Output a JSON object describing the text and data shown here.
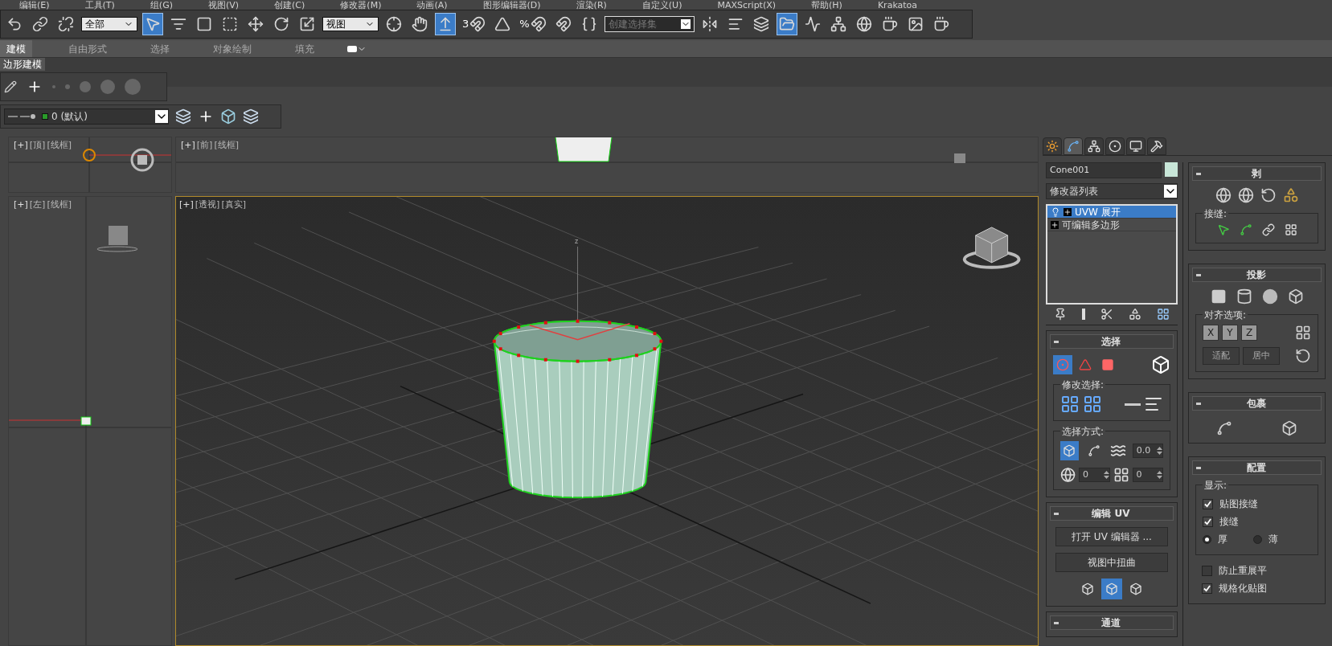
{
  "menu": [
    "编辑(E)",
    "工具(T)",
    "组(G)",
    "视图(V)",
    "创建(C)",
    "修改器(M)",
    "动画(A)",
    "图形编辑器(D)",
    "渲染(R)",
    "自定义(U)",
    "MAXScript(X)",
    "帮助(H)",
    "Krakatoa"
  ],
  "toolbar": [
    {
      "kind": "button",
      "selected": false
    },
    {
      "kind": "button",
      "selected": false
    },
    {
      "kind": "button",
      "selected": false
    },
    {
      "kind": "dropdown",
      "value": "全部"
    },
    {
      "kind": "button",
      "selected": true
    },
    {
      "kind": "button",
      "selected": false
    },
    {
      "kind": "button",
      "selected": false
    },
    {
      "kind": "button",
      "selected": false
    },
    {
      "kind": "button",
      "selected": false
    },
    {
      "kind": "button",
      "selected": false
    },
    {
      "kind": "button",
      "selected": false
    },
    {
      "kind": "dropdown",
      "value": "视图"
    },
    {
      "kind": "button",
      "selected": false
    },
    {
      "kind": "button",
      "selected": false
    },
    {
      "kind": "button",
      "selected": true
    },
    {
      "kind": "button",
      "selected": false,
      "label": "3"
    },
    {
      "kind": "button",
      "selected": false
    },
    {
      "kind": "button",
      "selected": false,
      "label": "%"
    },
    {
      "kind": "button",
      "selected": false
    },
    {
      "kind": "button",
      "selected": false
    },
    {
      "kind": "set_field",
      "placeholder": "创建选择集"
    },
    {
      "kind": "button",
      "selected": false
    },
    {
      "kind": "button",
      "selected": false
    },
    {
      "kind": "button",
      "selected": false
    },
    {
      "kind": "button",
      "selected": true
    },
    {
      "kind": "button",
      "selected": false
    },
    {
      "kind": "button",
      "selected": false
    },
    {
      "kind": "button",
      "selected": false
    },
    {
      "kind": "button",
      "selected": false
    },
    {
      "kind": "button",
      "selected": false
    },
    {
      "kind": "button",
      "selected": false
    }
  ],
  "ribbon": {
    "tabs": [
      {
        "label": "建模",
        "selected": true
      },
      {
        "label": "自由形式",
        "selected": false
      },
      {
        "label": "选择",
        "selected": false
      },
      {
        "label": "对象绘制",
        "selected": false
      },
      {
        "label": "填充",
        "selected": false
      }
    ],
    "panel_tab": "边形建模"
  },
  "layer": {
    "value": "0 (默认)"
  },
  "viewports": {
    "top": [
      "[+]",
      "[顶]",
      "[线框]"
    ],
    "front": [
      "[+]",
      "[前]",
      "[线框]"
    ],
    "left": [
      "[+]",
      "[左]",
      "[线框]"
    ],
    "perspective": [
      "[+]",
      "[透视]",
      "[真实]"
    ],
    "axis_label": "z"
  },
  "command_tabs": [
    {
      "selected": false
    },
    {
      "selected": true
    },
    {
      "selected": false
    },
    {
      "selected": false
    },
    {
      "selected": false
    },
    {
      "selected": false
    }
  ],
  "object_name": "Cone001",
  "modifier_list": "修改器列表",
  "stack": [
    {
      "label": "UVW 展开",
      "selected": true,
      "kind": "modifier"
    },
    {
      "label": "可编辑多边形",
      "selected": false,
      "kind": "base"
    }
  ],
  "selection": {
    "title": "选择",
    "subobject": [
      {
        "selected": true
      },
      {
        "selected": false
      },
      {
        "selected": false
      }
    ],
    "modify_label": "修改选择:",
    "method_label": "选择方式:",
    "method_buttons": [
      {
        "selected": true
      },
      {
        "selected": false
      }
    ],
    "angle": "0.0",
    "spin_a": "0",
    "spin_b": "0"
  },
  "edit_uv": {
    "title": "编辑 UV",
    "buttons": [
      "打开 UV 编辑器 ...",
      "视图中扭曲"
    ],
    "tools": [
      {
        "selected": false
      },
      {
        "selected": true
      },
      {
        "selected": false
      }
    ]
  },
  "channel": {
    "title": "通道"
  },
  "peel": {
    "title": "剥",
    "seams_label": "接缝:"
  },
  "projection": {
    "title": "投影",
    "align_label": "对齐选项:",
    "axes": [
      "X",
      "Y",
      "Z"
    ],
    "buttons": [
      "适配",
      "居中"
    ]
  },
  "wrap": {
    "title": "包裹"
  },
  "config": {
    "title": "配置",
    "display_label": "显示:",
    "checks": [
      {
        "label": "贴图接缝",
        "checked": true
      },
      {
        "label": "接缝",
        "checked": true
      }
    ],
    "radios": [
      {
        "label": "厚",
        "selected": true
      },
      {
        "label": "薄",
        "selected": false
      }
    ],
    "options": [
      {
        "label": "防止重展平",
        "checked": false
      },
      {
        "label": "规格化贴图",
        "checked": true
      }
    ]
  }
}
